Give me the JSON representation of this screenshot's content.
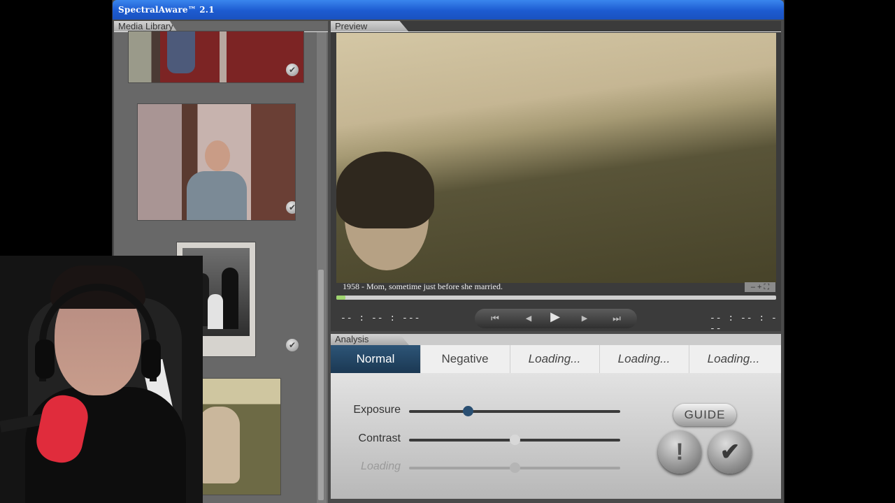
{
  "window": {
    "title": "SpectralAware™ 2.1"
  },
  "library": {
    "label": "Media Library",
    "items": [
      {
        "name": "photo-kid-red-door",
        "checked": true
      },
      {
        "name": "photo-woman-kitchen",
        "checked": true
      },
      {
        "name": "photo-family-portrait",
        "checked": true
      },
      {
        "name": "photo-woman-field-sitting",
        "checked": false
      }
    ]
  },
  "preview": {
    "label": "Preview",
    "caption": "1958 - Mom, sometime just before she married.",
    "zoom_controls": "– + ⛶",
    "time_left": "-- : -- : ---",
    "time_right": "-- : -- : ---",
    "progress": 0.02,
    "transport": {
      "skip_back": "⏮",
      "step_back": "◀",
      "play": "▶",
      "step_forward": "▶",
      "skip_forward": "⏭"
    }
  },
  "analysis": {
    "label": "Analysis",
    "tabs": [
      {
        "label": "Normal",
        "state": "active"
      },
      {
        "label": "Negative",
        "state": "normal"
      },
      {
        "label": "Loading...",
        "state": "loading"
      },
      {
        "label": "Loading...",
        "state": "loading"
      },
      {
        "label": "Loading...",
        "state": "loading"
      }
    ],
    "sliders": [
      {
        "label": "Exposure",
        "value": 0.28,
        "enabled": true
      },
      {
        "label": "Contrast",
        "value": 0.5,
        "enabled": true
      },
      {
        "label": "Loading",
        "value": 0.5,
        "enabled": false
      }
    ],
    "guide_label": "GUIDE",
    "alert_label": "!",
    "confirm_label": "✔"
  },
  "colors": {
    "titlebar": "#1d5bd0",
    "active_tab": "#1f3f5e",
    "exposure_knob": "#2a4f72",
    "contrast_knob": "#d8d8d8",
    "progress": "#9fd46f"
  }
}
